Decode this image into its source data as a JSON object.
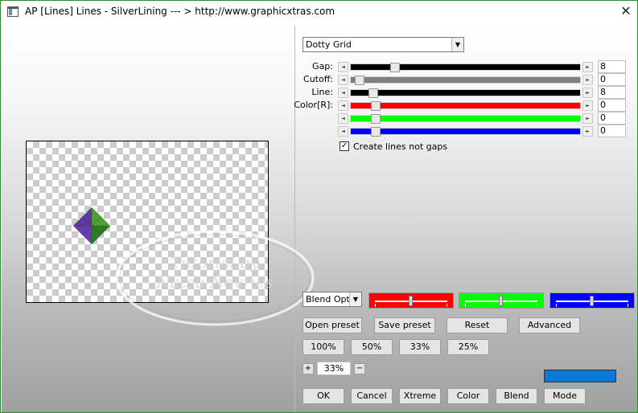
{
  "window": {
    "title": "AP [Lines]  Lines - SilverLining      --- > http://www.graphicxtras.com",
    "close_glyph": "✕",
    "border_color": "#2d8a2d"
  },
  "preview": {
    "watermark_line1": "Tutorial by",
    "watermark_line2": "Natsu Novries"
  },
  "effect": {
    "selected": "Dotty Grid"
  },
  "params": [
    {
      "label": "Gap:",
      "value": "8",
      "position": 0.18,
      "fill_color": "#000000",
      "fill_to_end": true
    },
    {
      "label": "Cutoff:",
      "value": "0",
      "position": 0.02,
      "fill_color": "#808080",
      "fill_to_end": true
    },
    {
      "label": "Line:",
      "value": "8",
      "position": 0.08,
      "fill_color": "#000000",
      "fill_to_end": true
    },
    {
      "label": "Color[R]:",
      "value": "0",
      "position": 0.09,
      "fill_color": "#ff0000",
      "fill_to_end": true
    },
    {
      "label": "",
      "value": "0",
      "position": 0.09,
      "fill_color": "#00ff00",
      "fill_to_end": true
    },
    {
      "label": "",
      "value": "0",
      "position": 0.09,
      "fill_color": "#0000ff",
      "fill_to_end": true
    }
  ],
  "checkbox": {
    "label": "Create lines not gaps",
    "checked": true,
    "mark": "✓"
  },
  "blend": {
    "selected": "Blend Optio",
    "swatches": [
      {
        "color": "#ff0000",
        "level": 0.5
      },
      {
        "color": "#00ff00",
        "level": 0.5
      },
      {
        "color": "#0000ff",
        "level": 0.5
      }
    ],
    "bar_color": "#0a78d7"
  },
  "buttons": {
    "open_preset": "Open preset",
    "save_preset": "Save preset",
    "reset": "Reset",
    "advanced": "Advanced",
    "zoom_100": "100%",
    "zoom_50": "50%",
    "zoom_33": "33%",
    "zoom_25": "25%",
    "ok": "OK",
    "cancel": "Cancel",
    "xtreme": "Xtreme",
    "color": "Color",
    "blend": "Blend",
    "mode": "Mode"
  },
  "zoom": {
    "plus": "+",
    "minus": "−",
    "value": "33%"
  },
  "icons": {
    "dropdown": "▼",
    "scroll_left": "◄",
    "scroll_right": "►"
  }
}
